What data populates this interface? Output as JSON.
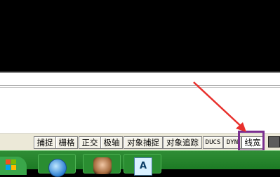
{
  "status_bar": {
    "toggles": [
      {
        "label": "捕捉"
      },
      {
        "label": "栅格"
      },
      {
        "label": "正交"
      },
      {
        "label": "极轴"
      },
      {
        "label": "对象捕捉"
      },
      {
        "label": "对象追踪"
      },
      {
        "label": "DUCS"
      },
      {
        "label": "DYN"
      },
      {
        "label": "线宽"
      }
    ]
  },
  "taskbar": {
    "acad_icon_text": "A"
  },
  "annotation": {
    "color": "#e8302c",
    "highlight_color": "#7a2f8f",
    "target": "线宽"
  }
}
